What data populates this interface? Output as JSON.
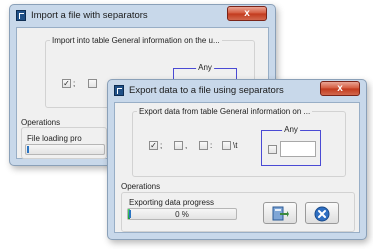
{
  "import_dialog": {
    "title": "Import a file with separators",
    "close_label": "x",
    "group_label": "Import into table General information on the u...",
    "checkbox_mark": "✓",
    "sep_semicolon": ";",
    "any_label": "Any",
    "operations_label": "Operations",
    "progress_label": "File loading pro"
  },
  "export_dialog": {
    "title": "Export data to a file using separators",
    "close_label": "x",
    "group_label": "Export data from table General information on ...",
    "checkbox_mark": "✓",
    "separators": [
      {
        "label": ";",
        "checked": true
      },
      {
        "label": ",",
        "checked": false
      },
      {
        "label": ":",
        "checked": false
      },
      {
        "label": "\\t",
        "checked": false
      }
    ],
    "any_label": "Any",
    "any_value": "",
    "operations_label": "Operations",
    "progress_label": "Exporting data progress",
    "progress_text": "0 %",
    "progress_value": 0.02,
    "icons": {
      "export_button": "export-to-file-icon",
      "cancel_button": "cancel-circle-icon"
    },
    "colors": {
      "accent_border": "#4a4ad4",
      "progress_fill": "#1da33a",
      "close_button": "#c23a1d"
    }
  }
}
